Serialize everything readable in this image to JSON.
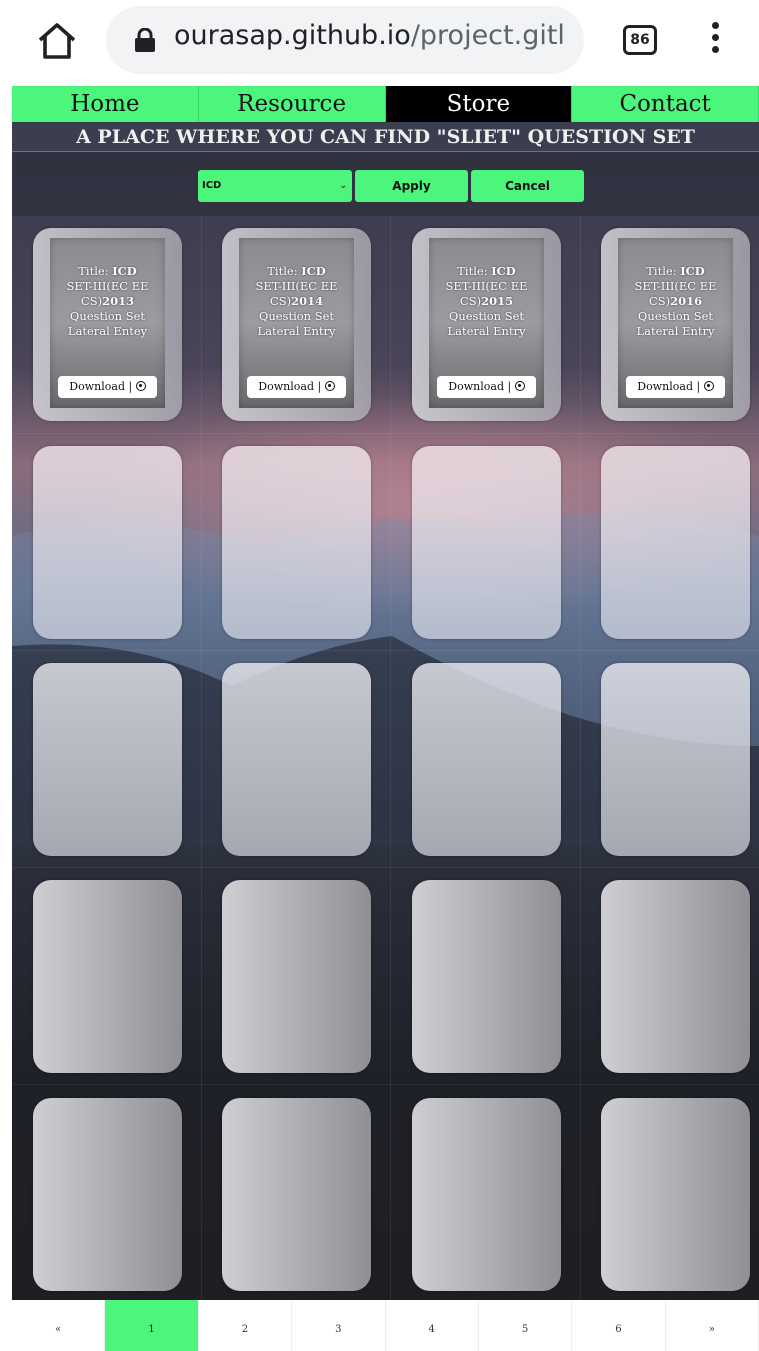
{
  "browser": {
    "url_domain": "ourasap.github.io",
    "url_path": "/project.gitl",
    "tab_count": "86"
  },
  "nav": {
    "items": [
      "Home",
      "Resource",
      "Store",
      "Contact"
    ],
    "active": "Store"
  },
  "headline": "A PLACE WHERE YOU CAN FIND \"SLIET\" QUESTION SET",
  "filter": {
    "selected": "ICD",
    "apply_label": "Apply",
    "cancel_label": "Cancel"
  },
  "cards": [
    {
      "title_label": "Title:",
      "title": "ICD",
      "set": "SET-III(EC EE CS)",
      "year": "2013",
      "line3": "Question Set",
      "line4": "Lateral Entey",
      "download_label": "Download"
    },
    {
      "title_label": "Title:",
      "title": "ICD",
      "set": "SET-III(EC EE CS)",
      "year": "2014",
      "line3": "Question Set",
      "line4": "Lateral Entry",
      "download_label": "Download"
    },
    {
      "title_label": "Title:",
      "title": "ICD",
      "set": "SET-III(EC EE CS)",
      "year": "2015",
      "line3": "Question Set",
      "line4": "Lateral Entry",
      "download_label": "Download"
    },
    {
      "title_label": "Title:",
      "title": "ICD",
      "set": "SET-III(EC EE CS)",
      "year": "2016",
      "line3": "Question Set",
      "line4": "Lateral Entry",
      "download_label": "Download"
    }
  ],
  "pagination": {
    "prev": "«",
    "pages": [
      "1",
      "2",
      "3",
      "4",
      "5",
      "6"
    ],
    "next": "»",
    "active": "1"
  },
  "colors": {
    "accent": "#4cf57c",
    "nav_active_bg": "#000000"
  }
}
